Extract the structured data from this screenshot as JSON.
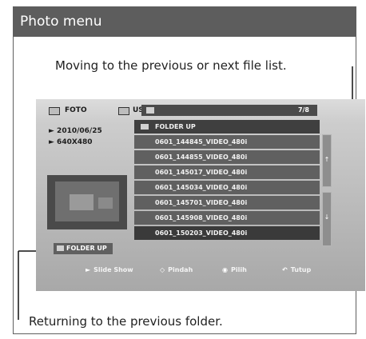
{
  "header": {
    "title": "Photo menu"
  },
  "annotations": {
    "top": "Moving to the previous or next file list.",
    "bottom": "Returning to the previous folder."
  },
  "screen": {
    "foto_label": "FOTO",
    "usb_label": "USB",
    "page_counter": "7/8",
    "info": {
      "date": "► 2010/06/25",
      "resolution": "► 640X480"
    },
    "folder_up_button": "FOLDER UP",
    "files": [
      "FOLDER UP",
      "0601_144845_VIDEO_480i",
      "0601_144855_VIDEO_480i",
      "0601_145017_VIDEO_480i",
      "0601_145034_VIDEO_480i",
      "0601_145701_VIDEO_480i",
      "0601_145908_VIDEO_480i",
      "0601_150203_VIDEO_480i"
    ],
    "hints": {
      "slideshow": "Slide Show",
      "move": "Pindah",
      "select": "Pilih",
      "close": "Tutup"
    },
    "icons": {
      "play": "►",
      "move": "◇",
      "select": "◉",
      "close": "↶"
    }
  },
  "colors": {
    "header_bg": "#5d5d5d",
    "row_bg": "#606060",
    "screen_bg": "#c2c2c2"
  }
}
